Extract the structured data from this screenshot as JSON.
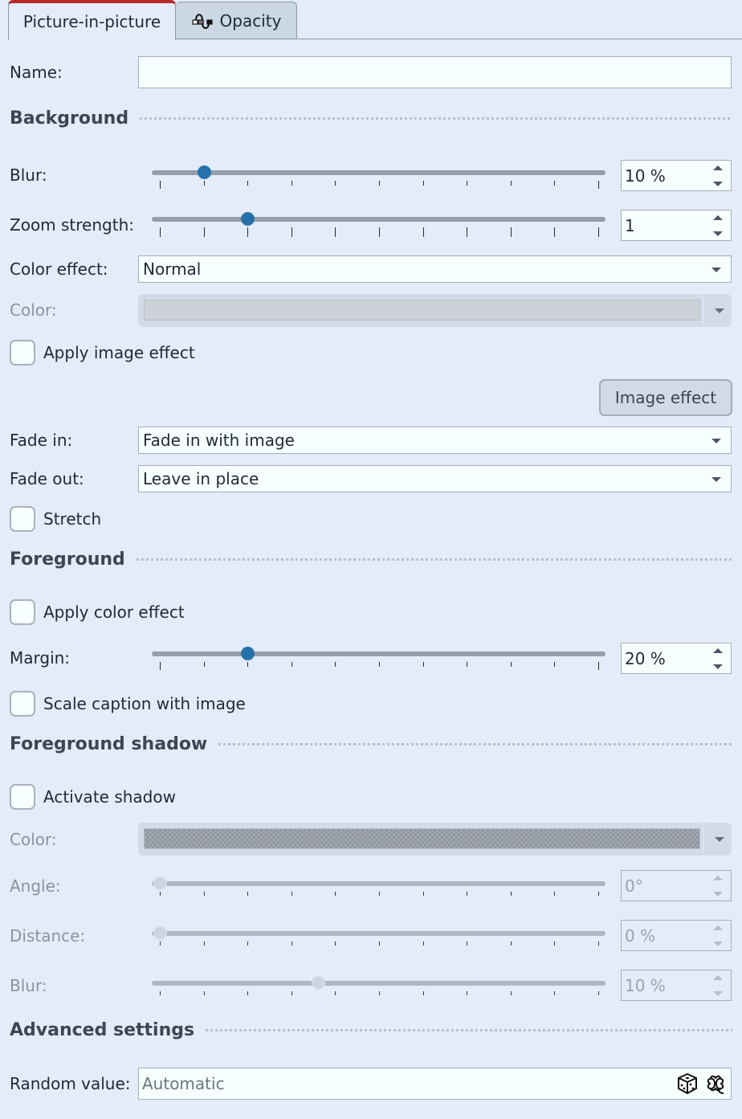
{
  "tabs": [
    {
      "label": "Picture-in-picture",
      "active": true
    },
    {
      "label": "Opacity",
      "active": false,
      "icon": "opacity-curve-icon"
    }
  ],
  "name": {
    "label": "Name:",
    "value": ""
  },
  "background": {
    "section_title": "Background",
    "blur": {
      "label": "Blur:",
      "value": "10 %",
      "slider_fraction": 0.1
    },
    "zoom_strength": {
      "label": "Zoom strength:",
      "value": "1",
      "slider_fraction": 0.2
    },
    "color_effect": {
      "label": "Color effect:",
      "value": "Normal"
    },
    "color": {
      "label": "Color:",
      "disabled": true
    },
    "apply_image_effect": {
      "label": "Apply image effect",
      "checked": false
    },
    "image_effect_button": "Image effect",
    "fade_in": {
      "label": "Fade in:",
      "value": "Fade in with image"
    },
    "fade_out": {
      "label": "Fade out:",
      "value": "Leave in place"
    },
    "stretch": {
      "label": "Stretch",
      "checked": false
    }
  },
  "foreground": {
    "section_title": "Foreground",
    "apply_color_effect": {
      "label": "Apply color effect",
      "checked": false
    },
    "margin": {
      "label": "Margin:",
      "value": "20 %",
      "slider_fraction": 0.2
    },
    "scale_caption": {
      "label": "Scale caption with image",
      "checked": false
    }
  },
  "foreground_shadow": {
    "section_title": "Foreground shadow",
    "activate_shadow": {
      "label": "Activate shadow",
      "checked": false
    },
    "color": {
      "label": "Color:",
      "disabled": true
    },
    "angle": {
      "label": "Angle:",
      "value": "0°",
      "slider_fraction": 0.0
    },
    "distance": {
      "label": "Distance:",
      "value": "0 %",
      "slider_fraction": 0.0
    },
    "blur": {
      "label": "Blur:",
      "value": "10 %",
      "slider_fraction": 0.36
    }
  },
  "advanced": {
    "section_title": "Advanced settings",
    "random_value": {
      "label": "Random value:",
      "placeholder": "Automatic",
      "icons": [
        "dice-icon",
        "clover-icon"
      ]
    }
  },
  "colors": {
    "background": "#e3ecf8",
    "active_tab_accent": "#b82a2a",
    "slider_thumb": "#2572ab"
  }
}
